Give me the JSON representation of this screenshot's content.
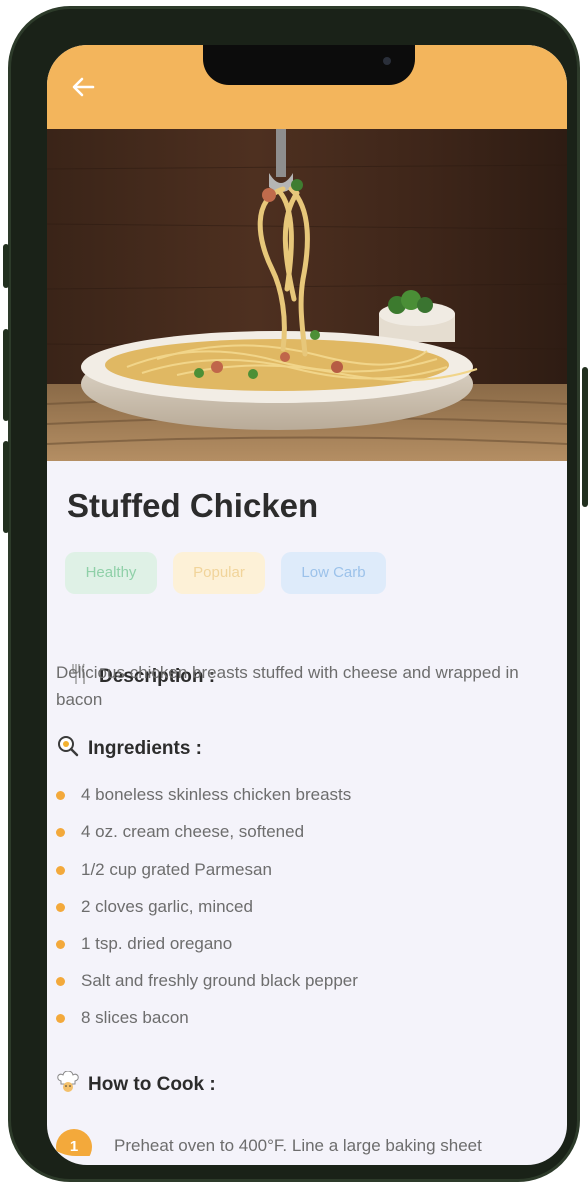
{
  "header": {
    "back_icon": "arrow-left-icon"
  },
  "recipe": {
    "title": "Stuffed Chicken",
    "tags": [
      {
        "label": "Healthy",
        "bg": "#dff1e6",
        "color": "#8fd0a8"
      },
      {
        "label": "Popular",
        "bg": "#fdf1d7",
        "color": "#f1d49a"
      },
      {
        "label": "Low Carb",
        "bg": "#deebfa",
        "color": "#9cc2ea"
      }
    ],
    "description": {
      "icon": "fork-knife-icon",
      "heading": "Description :",
      "text": "Delicious chicken breasts stuffed with cheese and wrapped in bacon"
    },
    "ingredients": {
      "icon": "magnifier-egg-icon",
      "heading": "Ingredients :",
      "items": [
        "4 boneless skinless chicken breasts",
        "4 oz. cream cheese, softened",
        "1/2 cup grated Parmesan",
        "2 cloves garlic, minced",
        "1 tsp. dried oregano",
        "Salt and freshly ground black pepper",
        "8 slices bacon"
      ]
    },
    "how_to_cook": {
      "icon": "chef-icon",
      "heading": "How to Cook :",
      "steps": [
        {
          "number": "1",
          "text": "Preheat oven to 400°F. Line a large baking sheet"
        }
      ]
    }
  },
  "colors": {
    "accent": "#f3b55c",
    "bullet": "#f3a93b",
    "background": "#f4f3fa"
  }
}
